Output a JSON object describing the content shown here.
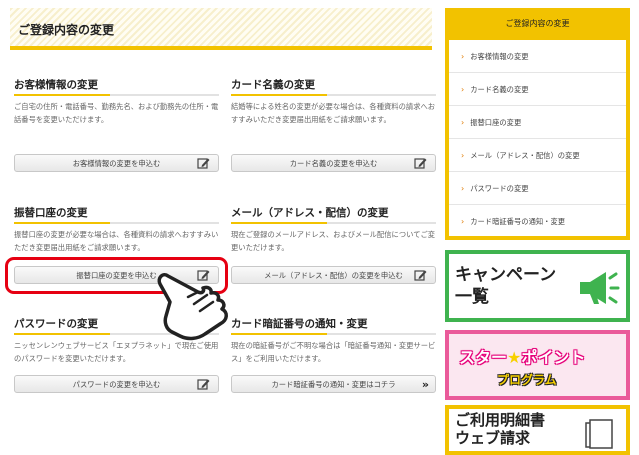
{
  "header": {
    "title": "ご登録内容の変更"
  },
  "sections": [
    {
      "title": "お客様情報の変更",
      "desc": "ご自宅の住所・電話番号、勤務先名、および勤務先の住所・電話番号を変更いただけます。",
      "button": "お客様情報の変更を申込む",
      "icon": "edit-icon"
    },
    {
      "title": "カード名義の変更",
      "desc": "結婚等による姓名の変更が必要な場合は、各種資料の請求へおすすみいただき変更届出用紙をご請求願います。",
      "button": "カード名義の変更を申込む",
      "icon": "edit-icon"
    },
    {
      "title": "振替口座の変更",
      "desc": "振替口座の変更が必要な場合は、各種資料の請求へおすすみいただき変更届出用紙をご請求願います。",
      "button": "振替口座の変更を申込む",
      "icon": "edit-icon"
    },
    {
      "title": "メール（アドレス・配信）の変更",
      "desc": "現在ご登録のメールアドレス、およびメール配信についてご変更いただけます。",
      "button": "メール（アドレス・配信）の変更を申込む",
      "icon": "edit-icon"
    },
    {
      "title": "パスワードの変更",
      "desc": "ニッセンレンウェブサービス「エヌプラネット」で現在ご使用のパスワードを変更いただけます。",
      "button": "パスワードの変更を申込む",
      "icon": "edit-icon"
    },
    {
      "title": "カード暗証番号の通知・変更",
      "desc": "現在の暗証番号がご不明な場合は「暗証番号通知・変更サービス」をご利用いただけます。",
      "button": "カード暗証番号の通知・変更はコチラ",
      "icon": "double-chevron-right-icon"
    }
  ],
  "sidebar": {
    "title": "ご登録内容の変更",
    "items": [
      "お客様情報の変更",
      "カード名義の変更",
      "振替口座の変更",
      "メール（アドレス・配信）の変更",
      "パスワードの変更",
      "カード暗証番号の通知・変更"
    ]
  },
  "banners": {
    "campaign": {
      "line1": "キャンペーン",
      "line2": "一覧",
      "color": "#3fb34f"
    },
    "star_point": {
      "part1": "スター",
      "star": "★",
      "part2": "ポイント",
      "line2": "プログラム",
      "color": "#ea5a9a"
    },
    "statement": {
      "line1": "ご利用明細書",
      "line2": "ウェブ請求"
    }
  },
  "colors": {
    "accent": "#f2c200",
    "highlight": "#e60012",
    "link_arrow": "#e07a00"
  }
}
